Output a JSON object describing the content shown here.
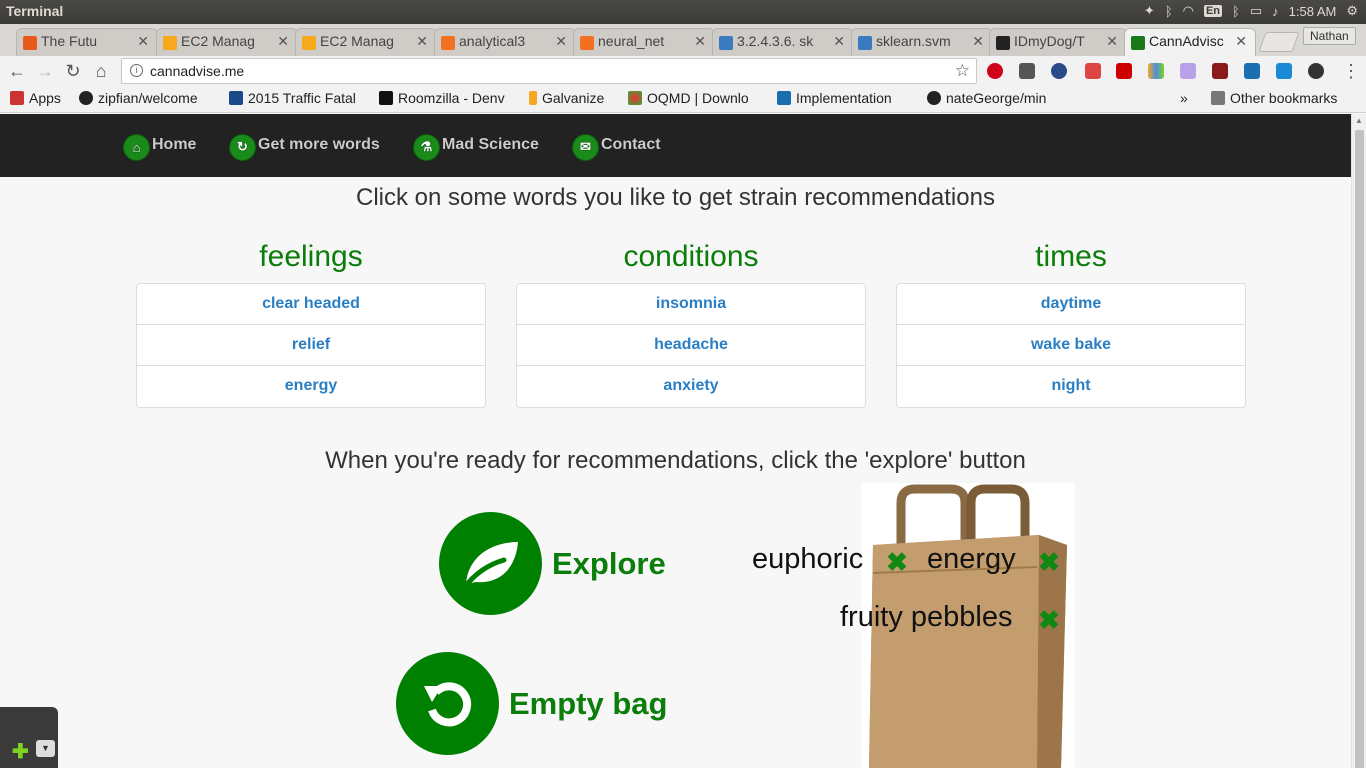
{
  "os": {
    "window_title": "Terminal",
    "keyboard": "En",
    "time": "1:58 AM"
  },
  "browser": {
    "tabs": [
      {
        "label": "The Futu",
        "color": "#e8581a"
      },
      {
        "label": "EC2 Manag",
        "color": "#f7a81b"
      },
      {
        "label": "EC2 Manag",
        "color": "#f7a81b"
      },
      {
        "label": "analytical3",
        "color": "#f37021"
      },
      {
        "label": "neural_net",
        "color": "#f37021"
      },
      {
        "label": "3.2.4.3.6. sk",
        "color": "#3a7abf"
      },
      {
        "label": "sklearn.svm",
        "color": "#3a7abf"
      },
      {
        "label": "IDmyDog/T",
        "color": "#222222"
      },
      {
        "label": "CannAdvisc",
        "color": "#1a7a1a"
      }
    ],
    "close_glyph": "✕",
    "profile": "Nathan",
    "url": "cannadvise.me",
    "bookmarks": [
      "Apps",
      "zipfian/welcome",
      "2015 Traffic Fatal",
      "Roomzilla - Denv",
      "Galvanize",
      "OQMD | Downlo",
      "Implementation",
      "nateGeorge/min"
    ],
    "more_bookmarks": "»",
    "other_bookmarks": "Other bookmarks"
  },
  "site": {
    "nav": [
      {
        "label": "Home",
        "icon": "home-icon"
      },
      {
        "label": "Get more words",
        "icon": "refresh-icon"
      },
      {
        "label": "Mad Science",
        "icon": "flask-icon"
      },
      {
        "label": "Contact",
        "icon": "envelope-icon"
      }
    ],
    "instructions": "Click on some words you like to get strain recommendations",
    "columns": [
      {
        "title": "feelings",
        "words": [
          "clear headed",
          "relief",
          "energy"
        ]
      },
      {
        "title": "conditions",
        "words": [
          "insomnia",
          "headache",
          "anxiety"
        ]
      },
      {
        "title": "times",
        "words": [
          "daytime",
          "wake bake",
          "night"
        ]
      }
    ],
    "ready_text": "When you're ready for recommendations, click the 'explore' button",
    "explore_label": "Explore",
    "empty_label": "Empty bag",
    "bag_items": [
      "euphoric",
      "energy",
      "fruity pebbles"
    ],
    "remove_glyph": "✖",
    "accent_color": "#008000",
    "link_color": "#2a7fc4"
  }
}
